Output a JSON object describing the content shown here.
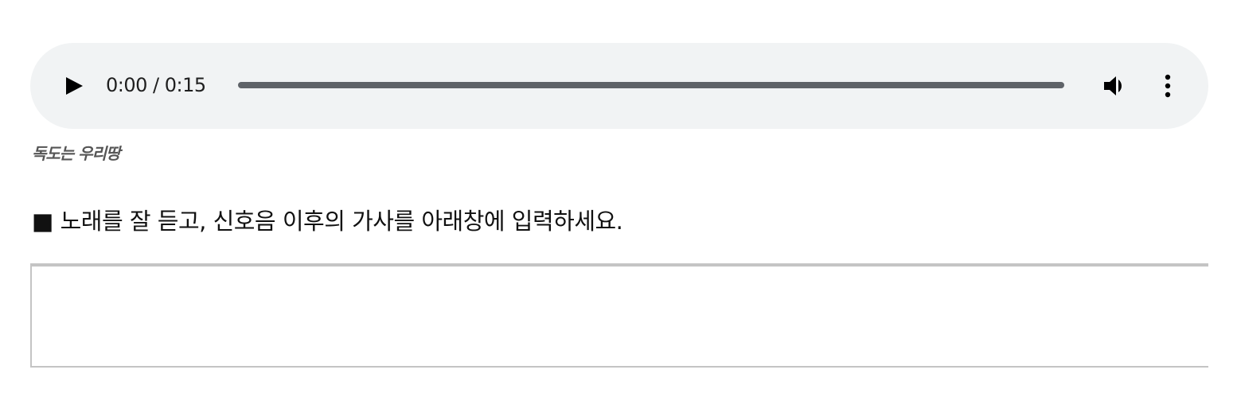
{
  "audio_player": {
    "time_text": "0:00 / 0:15",
    "progress": 0.0,
    "controls": {
      "play_icon": "play-icon",
      "volume_icon": "volume-icon",
      "more_icon": "more-vertical-icon"
    },
    "colors": {
      "background": "#f1f3f4",
      "track": "#5f6368",
      "icon": "#000000"
    }
  },
  "caption": {
    "text": "독도는 우리땅"
  },
  "instruction": {
    "text": "■ 노래를 잘 듣고, 신호음 이후의 가사를 아래창에 입력하세요."
  },
  "answer": {
    "value": "",
    "placeholder": ""
  }
}
